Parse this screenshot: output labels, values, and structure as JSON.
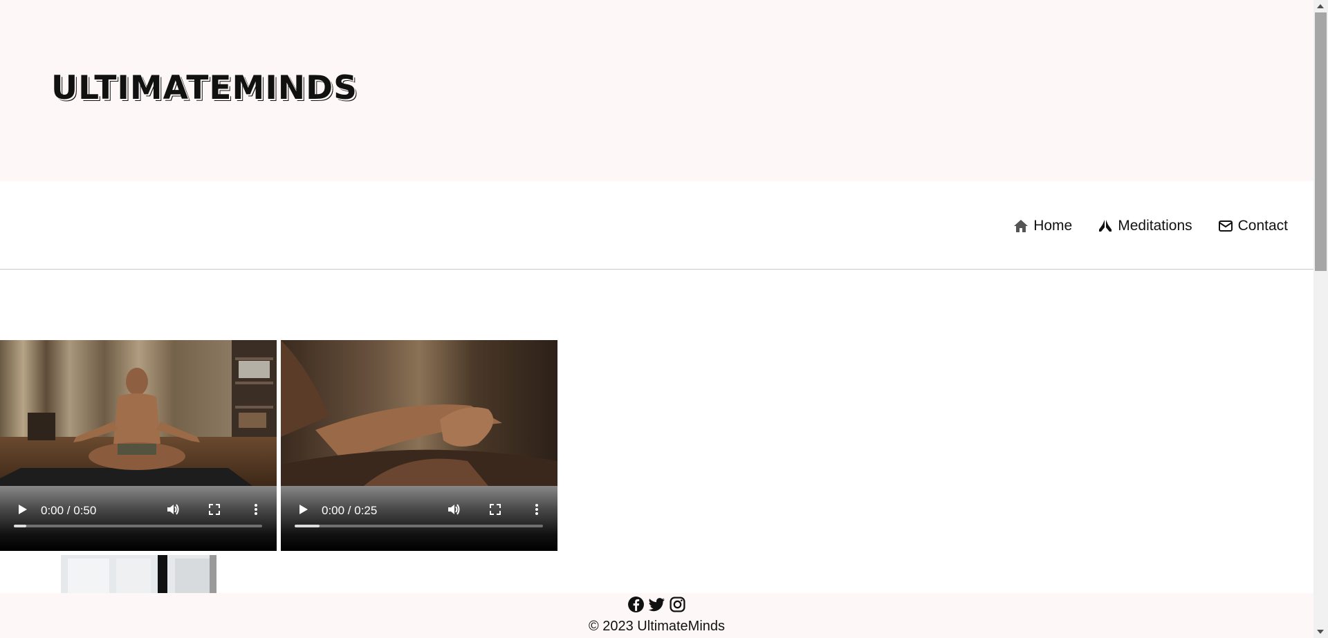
{
  "site": {
    "logo_text": "ULTIMATEMINDS",
    "header_bg": "#fdf8f7"
  },
  "nav": {
    "items": [
      {
        "label": "Home",
        "icon": "home-icon"
      },
      {
        "label": "Meditations",
        "icon": "praying-hands-icon"
      },
      {
        "label": "Contact",
        "icon": "envelope-icon"
      }
    ]
  },
  "videos": [
    {
      "time": "0:00 / 0:50",
      "progress": 0.05
    },
    {
      "time": "0:00 / 0:25",
      "progress": 0.1
    }
  ],
  "footer": {
    "social_icons": [
      "facebook-icon",
      "twitter-icon",
      "instagram-icon"
    ],
    "copyright": "© 2023 UltimateMinds"
  }
}
